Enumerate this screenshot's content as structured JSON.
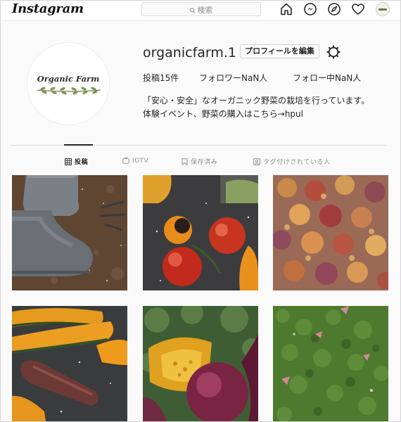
{
  "header": {
    "logo": "Instagram",
    "search_placeholder": "検索",
    "nav_icons": [
      "home-icon",
      "messenger-icon",
      "explore-icon",
      "activity-heart-icon",
      "profile-avatar-icon"
    ]
  },
  "profile": {
    "avatar_text": "Organic Farm",
    "username": "organicfarm.1",
    "edit_button": "プロフィールを編集",
    "stats": {
      "posts": "投稿15件",
      "followers": "フォロワーNaN人",
      "following": "フォロー中NaN人"
    },
    "bio_lines": [
      "「安心・安全」なオーガニック野菜の栽培を行っています。",
      "体験イベント、野菜の購入はこちら→hpul"
    ]
  },
  "tabs": [
    {
      "label": "投稿",
      "icon": "grid-icon",
      "active": true
    },
    {
      "label": "IGTV",
      "icon": "igtv-icon",
      "active": false
    },
    {
      "label": "保存済み",
      "icon": "bookmark-icon",
      "active": false
    },
    {
      "label": "タグ付けされている人",
      "icon": "tagged-person-icon",
      "active": false
    }
  ],
  "posts": [
    {
      "subject": "garden-boots-on-soil-photo"
    },
    {
      "subject": "roasted-tomatoes-photo"
    },
    {
      "subject": "autumn-maple-leaves-photo"
    },
    {
      "subject": "roasted-pumpkin-slices-photo"
    },
    {
      "subject": "pumpkin-and-eggplant-photo"
    },
    {
      "subject": "moss-with-leaves-photo"
    }
  ],
  "colors": {
    "text": "#262626",
    "muted": "#8e8e8e",
    "border": "#dbdbdb",
    "background": "#fafafa"
  }
}
